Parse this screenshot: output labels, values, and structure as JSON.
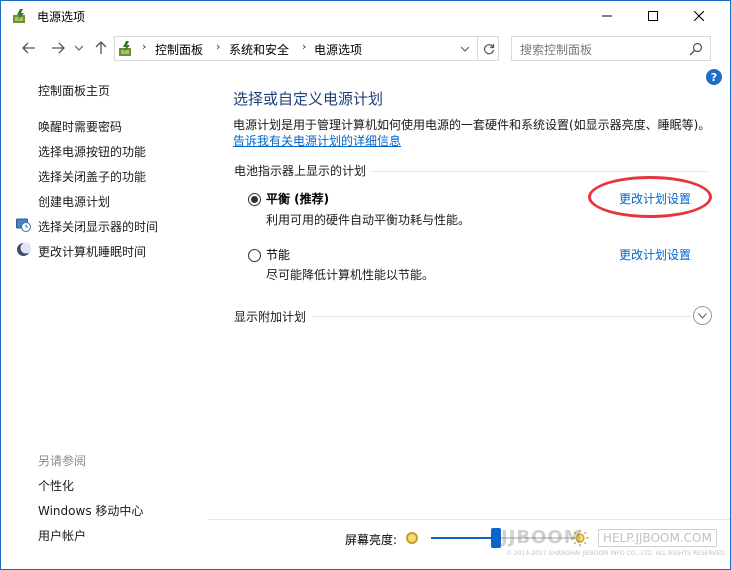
{
  "window": {
    "title": "电源选项"
  },
  "address_bar": {
    "crumbs": [
      "控制面板",
      "系统和安全",
      "电源选项"
    ],
    "search_placeholder": "搜索控制面板"
  },
  "left_pane": {
    "home_link": "控制面板主页",
    "links": [
      {
        "label": "唤醒时需要密码",
        "icon": null
      },
      {
        "label": "选择电源按钮的功能",
        "icon": null
      },
      {
        "label": "选择关闭盖子的功能",
        "icon": null
      },
      {
        "label": "创建电源计划",
        "icon": null
      },
      {
        "label": "选择关闭显示器的时间",
        "icon": "display-clock-icon"
      },
      {
        "label": "更改计算机睡眠时间",
        "icon": "moon-icon"
      }
    ],
    "see_also": {
      "heading": "另请参阅",
      "links": [
        "个性化",
        "Windows 移动中心",
        "用户帐户"
      ]
    }
  },
  "main": {
    "title": "选择或自定义电源计划",
    "description": "电源计划是用于管理计算机如何使用电源的一套硬件和系统设置(如显示器亮度、睡眠等)。",
    "detail_link": "告诉我有关电源计划的详细信息",
    "group_label": "电池指示器上显示的计划",
    "plans": [
      {
        "name": "平衡 (推荐)",
        "description": "利用可用的硬件自动平衡功耗与性能。",
        "selected": true,
        "link": "更改计划设置"
      },
      {
        "name": "节能",
        "description": "尽可能降低计算机性能以节能。",
        "selected": false,
        "link": "更改计划设置"
      }
    ],
    "more_plans_label": "显示附加计划"
  },
  "bottom_bar": {
    "brightness_label": "屏幕亮度:",
    "brightness_level": 0.45
  },
  "watermark": {
    "brand": "JJBOOM",
    "url": "HELP.JJBOOM.COM",
    "fine_print": "© 2014-2017 SHANGHAI JIEBOOM INFO CO., LTD. ALL RIGHTS RESERVED."
  },
  "colors": {
    "link": "#0066cc",
    "title": "#1e3f7a",
    "highlight": "#e8343c",
    "accent": "#0c66c9"
  }
}
